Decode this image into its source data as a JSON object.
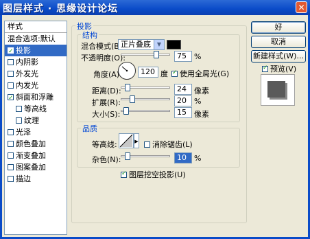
{
  "window": {
    "title": "图层样式 · 思缘设计论坛"
  },
  "left_panel": {
    "header": "样式",
    "blend_options": "混合选项:默认",
    "items": [
      {
        "label": "投影",
        "checked": true,
        "selected": true,
        "sub": false
      },
      {
        "label": "内阴影",
        "checked": false,
        "selected": false,
        "sub": false
      },
      {
        "label": "外发光",
        "checked": false,
        "selected": false,
        "sub": false
      },
      {
        "label": "内发光",
        "checked": false,
        "selected": false,
        "sub": false
      },
      {
        "label": "斜面和浮雕",
        "checked": true,
        "selected": false,
        "sub": false
      },
      {
        "label": "等高线",
        "checked": false,
        "selected": false,
        "sub": true
      },
      {
        "label": "纹理",
        "checked": false,
        "selected": false,
        "sub": true
      },
      {
        "label": "光泽",
        "checked": false,
        "selected": false,
        "sub": false
      },
      {
        "label": "颜色叠加",
        "checked": false,
        "selected": false,
        "sub": false
      },
      {
        "label": "渐变叠加",
        "checked": false,
        "selected": false,
        "sub": false
      },
      {
        "label": "图案叠加",
        "checked": false,
        "selected": false,
        "sub": false
      },
      {
        "label": "描边",
        "checked": false,
        "selected": false,
        "sub": false
      }
    ]
  },
  "drop_shadow": {
    "section_title": "投影",
    "structure": {
      "title": "结构",
      "blend_mode_label": "混合模式(B):",
      "blend_mode_value": "正片叠底",
      "color": "#000000",
      "opacity_label": "不透明度(O):",
      "opacity_value": "75",
      "opacity_fraction": 0.75,
      "opacity_unit": "%",
      "angle_label": "角度(A):",
      "angle_value": "120",
      "angle_unit": "度",
      "global_light_label": "使用全局光(G)",
      "global_light_checked": true,
      "distance_label": "距离(D):",
      "distance_value": "24",
      "distance_unit": "像素",
      "distance_fraction": 0.1,
      "spread_label": "扩展(R):",
      "spread_value": "20",
      "spread_unit": "%",
      "spread_fraction": 0.2,
      "size_label": "大小(S):",
      "size_value": "15",
      "size_unit": "像素",
      "size_fraction": 0.06
    },
    "quality": {
      "title": "品质",
      "contour_label": "等高线:",
      "antialias_label": "消除锯齿(L)",
      "antialias_checked": false,
      "noise_label": "杂色(N):",
      "noise_value": "10",
      "noise_unit": "%",
      "noise_fraction": 0.1
    },
    "knockout_label": "图层挖空投影(U)",
    "knockout_checked": true
  },
  "buttons": {
    "ok": "好",
    "cancel": "取消",
    "new_style": "新建样式(W)...",
    "preview_label": "预览(V)",
    "preview_checked": true
  }
}
